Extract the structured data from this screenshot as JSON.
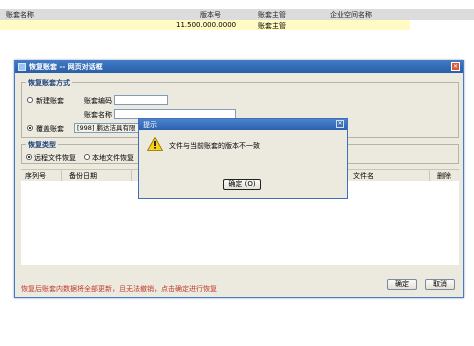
{
  "background": {
    "columns": [
      "账套名称",
      "版本号",
      "账套主管",
      "企业空间名称"
    ],
    "row": {
      "version": "11.500.000.0000",
      "manager": "账套主管"
    }
  },
  "dialog": {
    "title": "恢复账套 -- 网页对话框",
    "mode_section": {
      "legend": "恢复账套方式",
      "new_label": "新建账套",
      "cover_label": "覆盖账套",
      "code_label": "账套编码",
      "name_label": "账套名称",
      "code_value": "",
      "name_value": "",
      "cover_value": "[998] 鹏达洁具有限"
    },
    "type_section": {
      "legend": "恢复类型",
      "remote_label": "远程文件恢复",
      "local_label": "本地文件恢复"
    },
    "table": {
      "headers": {
        "seq": "序列号",
        "date": "备份日期",
        "file": "文件名",
        "delete": "删除"
      }
    },
    "warning": "恢复后账套内数据将全部更新，且无法撤销，点击确定进行恢复",
    "ok_label": "确定",
    "cancel_label": "取消"
  },
  "messagebox": {
    "title": "提示",
    "message": "文件与当前账套的版本不一致",
    "ok_label": "确定 (O)"
  }
}
